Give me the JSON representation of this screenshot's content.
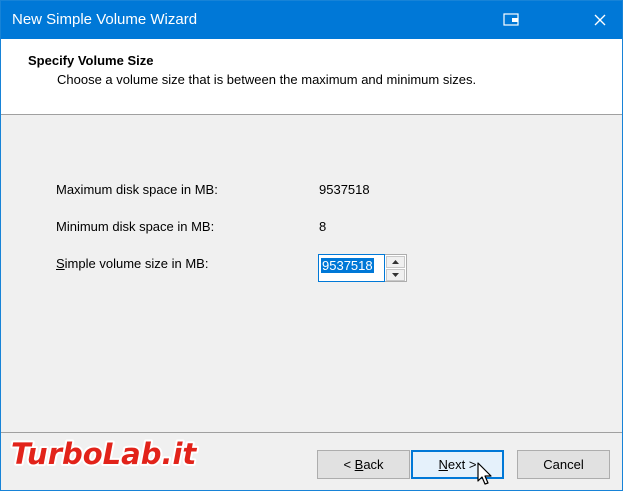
{
  "window": {
    "title": "New Simple Volume Wizard"
  },
  "header": {
    "title": "Specify Volume Size",
    "subtitle": "Choose a volume size that is between the maximum and minimum sizes."
  },
  "fields": {
    "max_label": "Maximum disk space in MB:",
    "max_value": "9537518",
    "min_label": "Minimum disk space in MB:",
    "min_value": "8",
    "size_label_first": "S",
    "size_label_rest": "imple volume size in MB:",
    "size_value": "9537518"
  },
  "watermark": {
    "text": "TurboLab.it"
  },
  "buttons": {
    "back_prefix": "< ",
    "back_accel": "B",
    "back_rest": "ack",
    "next_accel": "N",
    "next_rest": "ext >",
    "cancel": "Cancel"
  },
  "colors": {
    "titlebar": "#0078d7",
    "selection": "#0078d7",
    "watermark_red": "#e2231a"
  }
}
